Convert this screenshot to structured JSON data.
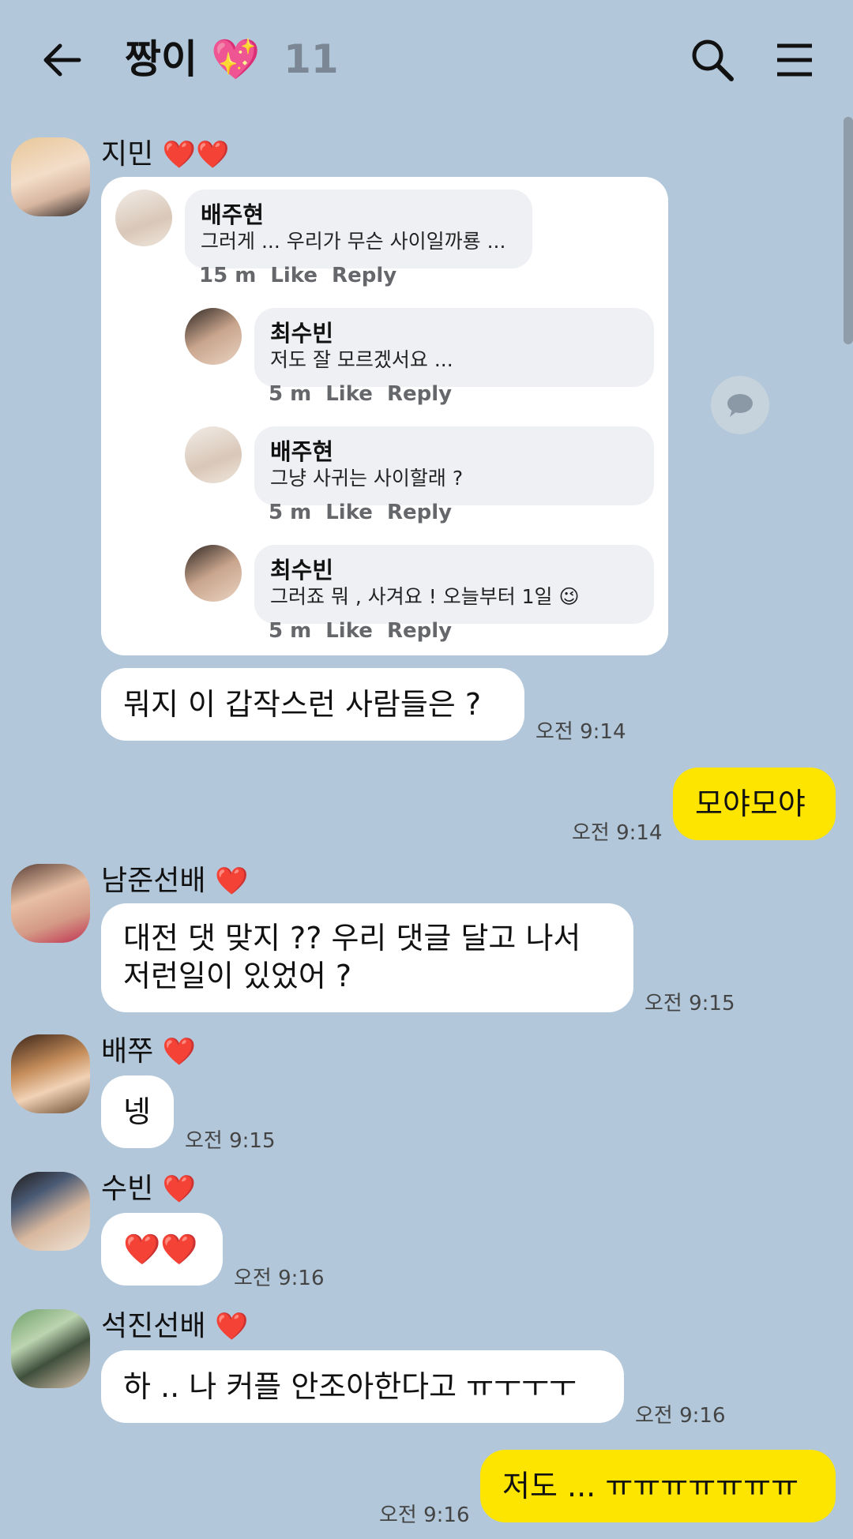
{
  "header": {
    "title": "짱이",
    "emoji": "💖",
    "member_count": "11"
  },
  "post": {
    "comments": [
      {
        "name": "배주현",
        "text": "그러게 ... 우리가 무슨 사이일까룡 ...",
        "time": "15 m",
        "like": "Like",
        "reply": "Reply"
      },
      {
        "name": "최수빈",
        "text": "저도 잘 모르겠서요 ...",
        "time": "5 m",
        "like": "Like",
        "reply": "Reply"
      },
      {
        "name": "배주현",
        "text": "그냥 사귀는 사이할래 ?",
        "time": "5 m",
        "like": "Like",
        "reply": "Reply"
      },
      {
        "name": "최수빈",
        "text": "그러죠 뭐 , 사겨요 ! 오늘부터 1일 😉",
        "time": "5 m",
        "like": "Like",
        "reply": "Reply"
      }
    ]
  },
  "messages": {
    "m1": {
      "sender": "지민",
      "hearts": "❤️❤️",
      "text": "뭐지 이 갑작스런 사람들은 ?",
      "time": "오전 9:14"
    },
    "m2": {
      "text": "모야모야",
      "time": "오전 9:14"
    },
    "m3": {
      "sender": "남준선배",
      "hearts": "❤️",
      "line1": "대전 댓 맞지 ?? 우리 댓글 달고 나서",
      "line2": "저런일이 있었어 ?",
      "time": "오전 9:15"
    },
    "m4": {
      "sender": "배쭈",
      "hearts": "❤️",
      "text": "넹",
      "time": "오전 9:15"
    },
    "m5": {
      "sender": "수빈",
      "hearts": "❤️",
      "text": "❤️❤️",
      "time": "오전 9:16"
    },
    "m6": {
      "sender": "석진선배",
      "hearts": "❤️",
      "text": "하 .. 나 커플 안조아한다고 ㅠㅜㅜㅜ",
      "time": "오전 9:16"
    },
    "m7": {
      "text": "저도 ... ㅠㅠㅠㅠㅠㅠㅠ",
      "time": "오전 9:16"
    }
  },
  "colors": {
    "background": "#b2c7da",
    "my_bubble": "#fee500",
    "their_bubble": "#ffffff",
    "heart": "#e53935"
  }
}
